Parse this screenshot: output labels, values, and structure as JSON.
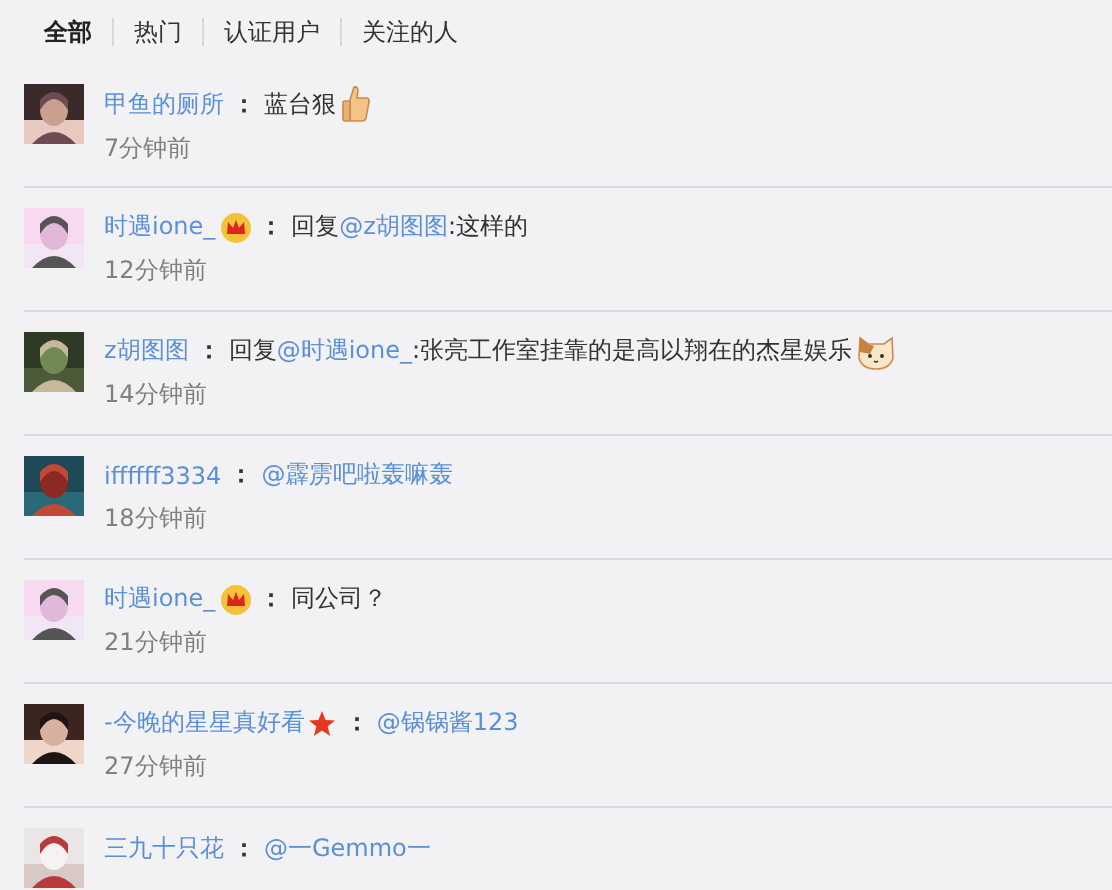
{
  "tabs": [
    {
      "label": "全部",
      "selected": true
    },
    {
      "label": "热门",
      "selected": false
    },
    {
      "label": "认证用户",
      "selected": false
    },
    {
      "label": "关注的人",
      "selected": false
    }
  ],
  "comments": [
    {
      "user": "甲鱼的厕所",
      "separator": "：",
      "parts": [
        {
          "kind": "text",
          "text": "蓝台狠"
        },
        {
          "kind": "thumb"
        }
      ],
      "time": "7分钟前"
    },
    {
      "user": "时遇ione_",
      "user_badge": {
        "kind": "crown"
      },
      "separator": "：",
      "parts": [
        {
          "kind": "text",
          "text": "回复"
        },
        {
          "kind": "mention",
          "text": "@z胡图图"
        },
        {
          "kind": "text",
          "text": ":这样的"
        }
      ],
      "time": "12分钟前"
    },
    {
      "user": "z胡图图",
      "separator": "：",
      "parts": [
        {
          "kind": "text",
          "text": "回复"
        },
        {
          "kind": "mention",
          "text": "@时遇ione_"
        },
        {
          "kind": "text",
          "text": ":张亮工作室挂靠的是高以翔在的杰星娱乐"
        },
        {
          "kind": "cat"
        }
      ],
      "time": "14分钟前"
    },
    {
      "user": "iffffff3334",
      "separator": "：",
      "parts": [
        {
          "kind": "mention",
          "text": "@霹雳吧啦轰嘛轰"
        }
      ],
      "time": "18分钟前"
    },
    {
      "user": "时遇ione_",
      "user_badge": {
        "kind": "crown"
      },
      "separator": "：",
      "parts": [
        {
          "kind": "text",
          "text": "同公司？"
        }
      ],
      "time": "21分钟前"
    },
    {
      "user": "-今晚的星星真好看",
      "user_badge": {
        "kind": "star"
      },
      "separator": "：",
      "parts": [
        {
          "kind": "mention",
          "text": "@锅锅酱123"
        }
      ],
      "time": "27分钟前"
    },
    {
      "user": "三九十只花",
      "separator": "：",
      "parts": [
        {
          "kind": "mention",
          "text": "@一Gemmo一"
        }
      ]
    }
  ]
}
